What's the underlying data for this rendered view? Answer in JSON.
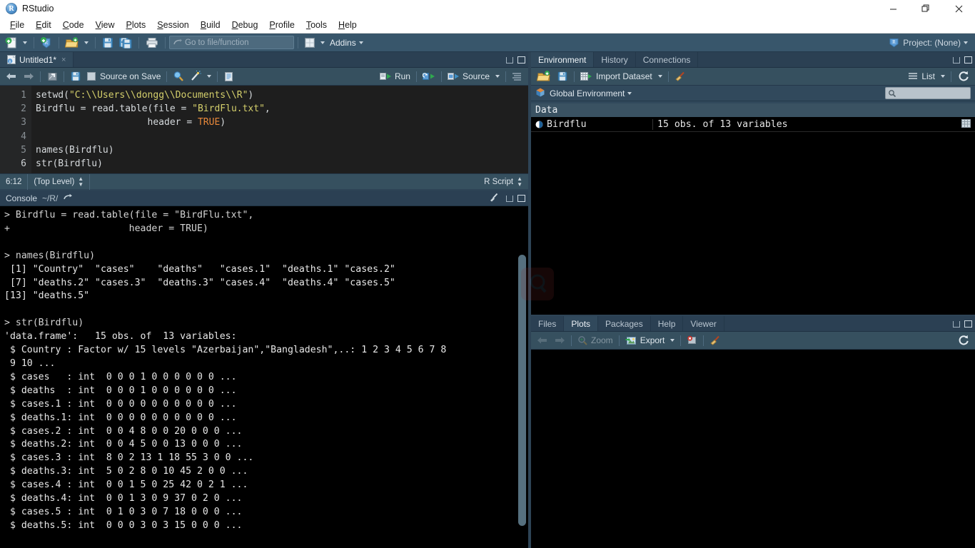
{
  "window": {
    "title": "RStudio",
    "app_icon": "rstudio-logo-icon",
    "minimize": "–",
    "maximize": "❐",
    "close": "✕"
  },
  "menubar": {
    "items": [
      {
        "label": "File",
        "mnemonic": "F"
      },
      {
        "label": "Edit",
        "mnemonic": "E"
      },
      {
        "label": "Code",
        "mnemonic": "C"
      },
      {
        "label": "View",
        "mnemonic": "V"
      },
      {
        "label": "Plots",
        "mnemonic": "P"
      },
      {
        "label": "Session",
        "mnemonic": "S"
      },
      {
        "label": "Build",
        "mnemonic": "B"
      },
      {
        "label": "Debug",
        "mnemonic": "D"
      },
      {
        "label": "Profile",
        "mnemonic": "P"
      },
      {
        "label": "Tools",
        "mnemonic": "T"
      },
      {
        "label": "Help",
        "mnemonic": "H"
      }
    ]
  },
  "toolbar": {
    "new_file": "new-file-icon",
    "new_project": "new-project-icon",
    "open_file": "open-folder-icon",
    "save": "save-icon",
    "save_all": "save-all-icon",
    "print": "print-icon",
    "goto_placeholder": "Go to file/function",
    "workspace_panes": "pane-layout-icon",
    "addins_label": "Addins",
    "project_label": "Project: (None)"
  },
  "source": {
    "tab": {
      "label": "Untitled1*",
      "icon": "r-script-icon",
      "close": "×"
    },
    "toolbar": {
      "back": "back-arrow-icon",
      "forward": "forward-arrow-icon",
      "popout": "show-in-new-window-icon",
      "save": "save-icon",
      "source_on_save_label": "Source on Save",
      "find": "find-icon",
      "magic": "code-tools-icon",
      "compile_report": "compile-report-icon",
      "run_label": "Run",
      "rerun": "rerun-icon",
      "source_label": "Source",
      "outline": "document-outline-icon"
    },
    "lines": [
      {
        "n": "1",
        "tokens": [
          {
            "t": "setwd(",
            "c": "plain"
          },
          {
            "t": "\"C:\\\\Users\\\\dongg\\\\Documents\\\\R\"",
            "c": "str"
          },
          {
            "t": ")",
            "c": "plain"
          }
        ]
      },
      {
        "n": "2",
        "tokens": [
          {
            "t": "Birdflu = read.table(file = ",
            "c": "plain"
          },
          {
            "t": "\"BirdFlu.txt\"",
            "c": "str"
          },
          {
            "t": ",",
            "c": "plain"
          }
        ]
      },
      {
        "n": "3",
        "tokens": [
          {
            "t": "                    header = ",
            "c": "plain"
          },
          {
            "t": "TRUE",
            "c": "const"
          },
          {
            "t": ")",
            "c": "plain"
          }
        ]
      },
      {
        "n": "4",
        "tokens": [
          {
            "t": "",
            "c": "plain"
          }
        ]
      },
      {
        "n": "5",
        "tokens": [
          {
            "t": "names(Birdflu)",
            "c": "plain"
          }
        ]
      },
      {
        "n": "6",
        "tokens": [
          {
            "t": "str(Birdflu)",
            "c": "plain"
          }
        ]
      }
    ],
    "status": {
      "cursor": "6:12",
      "scope": "(Top Level)",
      "filetype": "R Script"
    }
  },
  "console": {
    "title": "Console",
    "path": "~/R/",
    "popout_icon": "popout-icon",
    "broom_icon": "clear-console-icon",
    "lines": [
      {
        "c": "prompt",
        "t": "> Birdflu = read.table(file = \"BirdFlu.txt\","
      },
      {
        "c": "prompt",
        "t": "+                     header = TRUE)"
      },
      {
        "c": "out",
        "t": ""
      },
      {
        "c": "prompt",
        "t": "> names(Birdflu)"
      },
      {
        "c": "out",
        "t": " [1] \"Country\"  \"cases\"    \"deaths\"   \"cases.1\"  \"deaths.1\" \"cases.2\""
      },
      {
        "c": "out",
        "t": " [7] \"deaths.2\" \"cases.3\"  \"deaths.3\" \"cases.4\"  \"deaths.4\" \"cases.5\""
      },
      {
        "c": "out",
        "t": "[13] \"deaths.5\""
      },
      {
        "c": "out",
        "t": ""
      },
      {
        "c": "prompt",
        "t": "> str(Birdflu)"
      },
      {
        "c": "out",
        "t": "'data.frame':   15 obs. of  13 variables:"
      },
      {
        "c": "out",
        "t": " $ Country : Factor w/ 15 levels \"Azerbaijan\",\"Bangladesh\",..: 1 2 3 4 5 6 7 8"
      },
      {
        "c": "out",
        "t": " 9 10 ..."
      },
      {
        "c": "out",
        "t": " $ cases   : int  0 0 0 1 0 0 0 0 0 0 ..."
      },
      {
        "c": "out",
        "t": " $ deaths  : int  0 0 0 1 0 0 0 0 0 0 ..."
      },
      {
        "c": "out",
        "t": " $ cases.1 : int  0 0 0 0 0 0 0 0 0 0 ..."
      },
      {
        "c": "out",
        "t": " $ deaths.1: int  0 0 0 0 0 0 0 0 0 0 ..."
      },
      {
        "c": "out",
        "t": " $ cases.2 : int  0 0 4 8 0 0 20 0 0 0 ..."
      },
      {
        "c": "out",
        "t": " $ deaths.2: int  0 0 4 5 0 0 13 0 0 0 ..."
      },
      {
        "c": "out",
        "t": " $ cases.3 : int  8 0 2 13 1 18 55 3 0 0 ..."
      },
      {
        "c": "out",
        "t": " $ deaths.3: int  5 0 2 8 0 10 45 2 0 0 ..."
      },
      {
        "c": "out",
        "t": " $ cases.4 : int  0 0 1 5 0 25 42 0 2 1 ..."
      },
      {
        "c": "out",
        "t": " $ deaths.4: int  0 0 1 3 0 9 37 0 2 0 ..."
      },
      {
        "c": "out",
        "t": " $ cases.5 : int  0 1 0 3 0 7 18 0 0 0 ..."
      },
      {
        "c": "out",
        "t": " $ deaths.5: int  0 0 0 3 0 3 15 0 0 0 ..."
      }
    ]
  },
  "environment": {
    "tabs": [
      {
        "label": "Environment",
        "active": true
      },
      {
        "label": "History",
        "active": false
      },
      {
        "label": "Connections",
        "active": false
      }
    ],
    "toolbar": {
      "load": "open-folder-icon",
      "save": "save-icon",
      "import_label": "Import Dataset",
      "broom": "clear-objects-icon",
      "view_label": "List",
      "refresh": "refresh-icon",
      "list_icon": "list-view-icon"
    },
    "scope": "Global Environment",
    "scope_icon": "environment-cube-icon",
    "search_placeholder": "",
    "search_icon": "search-icon",
    "sections": [
      {
        "title": "Data",
        "rows": [
          {
            "name": "Birdflu",
            "value": "15 obs. of 13 variables",
            "expand_icon": "expand-triangle-icon",
            "grid_icon": "view-data-grid-icon"
          }
        ]
      }
    ]
  },
  "plots": {
    "tabs": [
      {
        "label": "Files",
        "active": false
      },
      {
        "label": "Plots",
        "active": true
      },
      {
        "label": "Packages",
        "active": false
      },
      {
        "label": "Help",
        "active": false
      },
      {
        "label": "Viewer",
        "active": false
      }
    ],
    "toolbar": {
      "back": "back-arrow-icon",
      "forward": "forward-arrow-icon",
      "zoom_label": "Zoom",
      "zoom_icon": "zoom-magnifier-icon",
      "export_label": "Export",
      "export_icon": "export-image-icon",
      "remove": "remove-plot-icon",
      "clear_all": "clear-all-plots-icon",
      "refresh": "refresh-icon"
    }
  },
  "colors": {
    "accent_blue": "#2e4456",
    "toolbar_blue": "#38566b",
    "pane_header": "#2b4053",
    "pane_toolbar": "#36505f",
    "editor_bg": "#1e1e1e",
    "console_bg": "#000000",
    "string_yellow": "#d4cf6b",
    "constant_orange": "#e8883a",
    "text_light": "#d6dadd"
  }
}
